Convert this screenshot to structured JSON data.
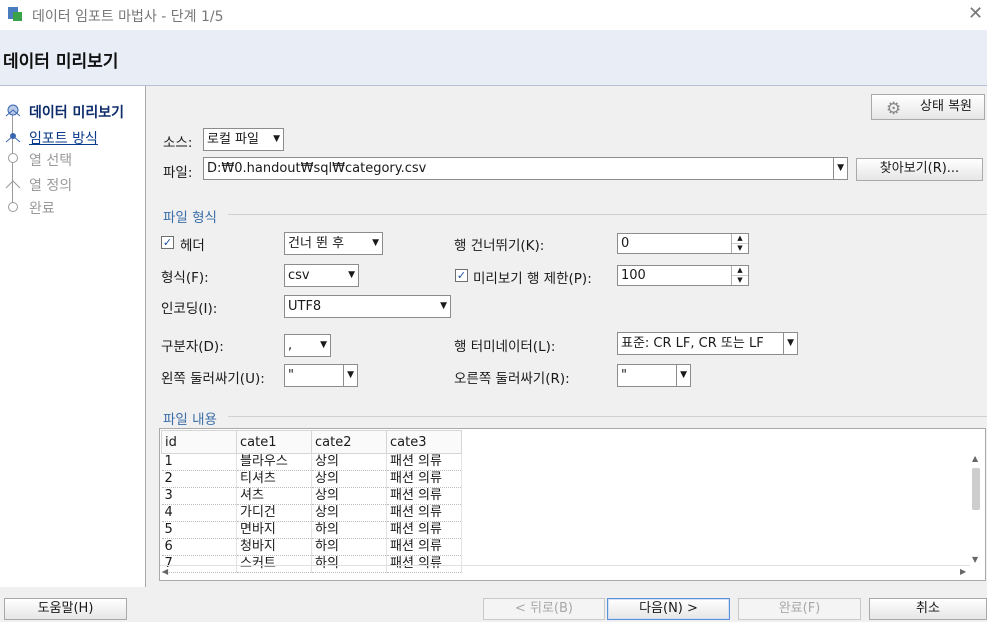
{
  "window": {
    "title": "데이터 임포트 마법사 - 단계 1/5"
  },
  "header": {
    "title": "데이터 미리보기"
  },
  "steps": [
    {
      "label": "데이터 미리보기"
    },
    {
      "label": "임포트 방식"
    },
    {
      "label": "열 선택"
    },
    {
      "label": "열 정의"
    },
    {
      "label": "완료"
    }
  ],
  "toolbar": {
    "restore_state": "상태 복원"
  },
  "source": {
    "label": "소스:",
    "value": "로컬 파일"
  },
  "file": {
    "label": "파일:",
    "value": "D:₩0.handout₩sql₩category.csv",
    "browse": "찾아보기(R)..."
  },
  "format_section": {
    "legend": "파일 형식",
    "header_label": "헤더",
    "header_checked": true,
    "header_option": "건너 뛴 후",
    "format_label": "형식(F):",
    "format_value": "csv",
    "encoding_label": "인코딩(I):",
    "encoding_value": "UTF8",
    "delimiter_label": "구분자(D):",
    "delimiter_value": ",",
    "left_enclosure_label": "왼쪽 둘러싸기(U):",
    "left_enclosure_value": "\"",
    "skip_rows_label": "행 건너뛰기(K):",
    "skip_rows_value": "0",
    "limit_label": "미리보기 행 제한(P):",
    "limit_checked": true,
    "limit_value": "100",
    "terminator_label": "행 터미네이터(L):",
    "terminator_value": "표준: CR LF, CR 또는 LF",
    "right_enclosure_label": "오른쪽 둘러싸기(R):",
    "right_enclosure_value": "\""
  },
  "content_section": {
    "legend": "파일 내용",
    "columns": [
      "id",
      "cate1",
      "cate2",
      "cate3"
    ],
    "rows": [
      [
        "1",
        "블라우스",
        "상의",
        "패션 의류"
      ],
      [
        "2",
        "티셔츠",
        "상의",
        "패션 의류"
      ],
      [
        "3",
        "셔츠",
        "상의",
        "패션 의류"
      ],
      [
        "4",
        "가디건",
        "상의",
        "패션 의류"
      ],
      [
        "5",
        "면바지",
        "하의",
        "패션 의류"
      ],
      [
        "6",
        "청바지",
        "하의",
        "패션 의류"
      ],
      [
        "7",
        "스커트",
        "하의",
        "패션 의류"
      ]
    ]
  },
  "footer": {
    "help": "도움말(H)",
    "back": "< 뒤로(B)",
    "next": "다음(N) >",
    "finish": "완료(F)",
    "cancel": "취소"
  }
}
